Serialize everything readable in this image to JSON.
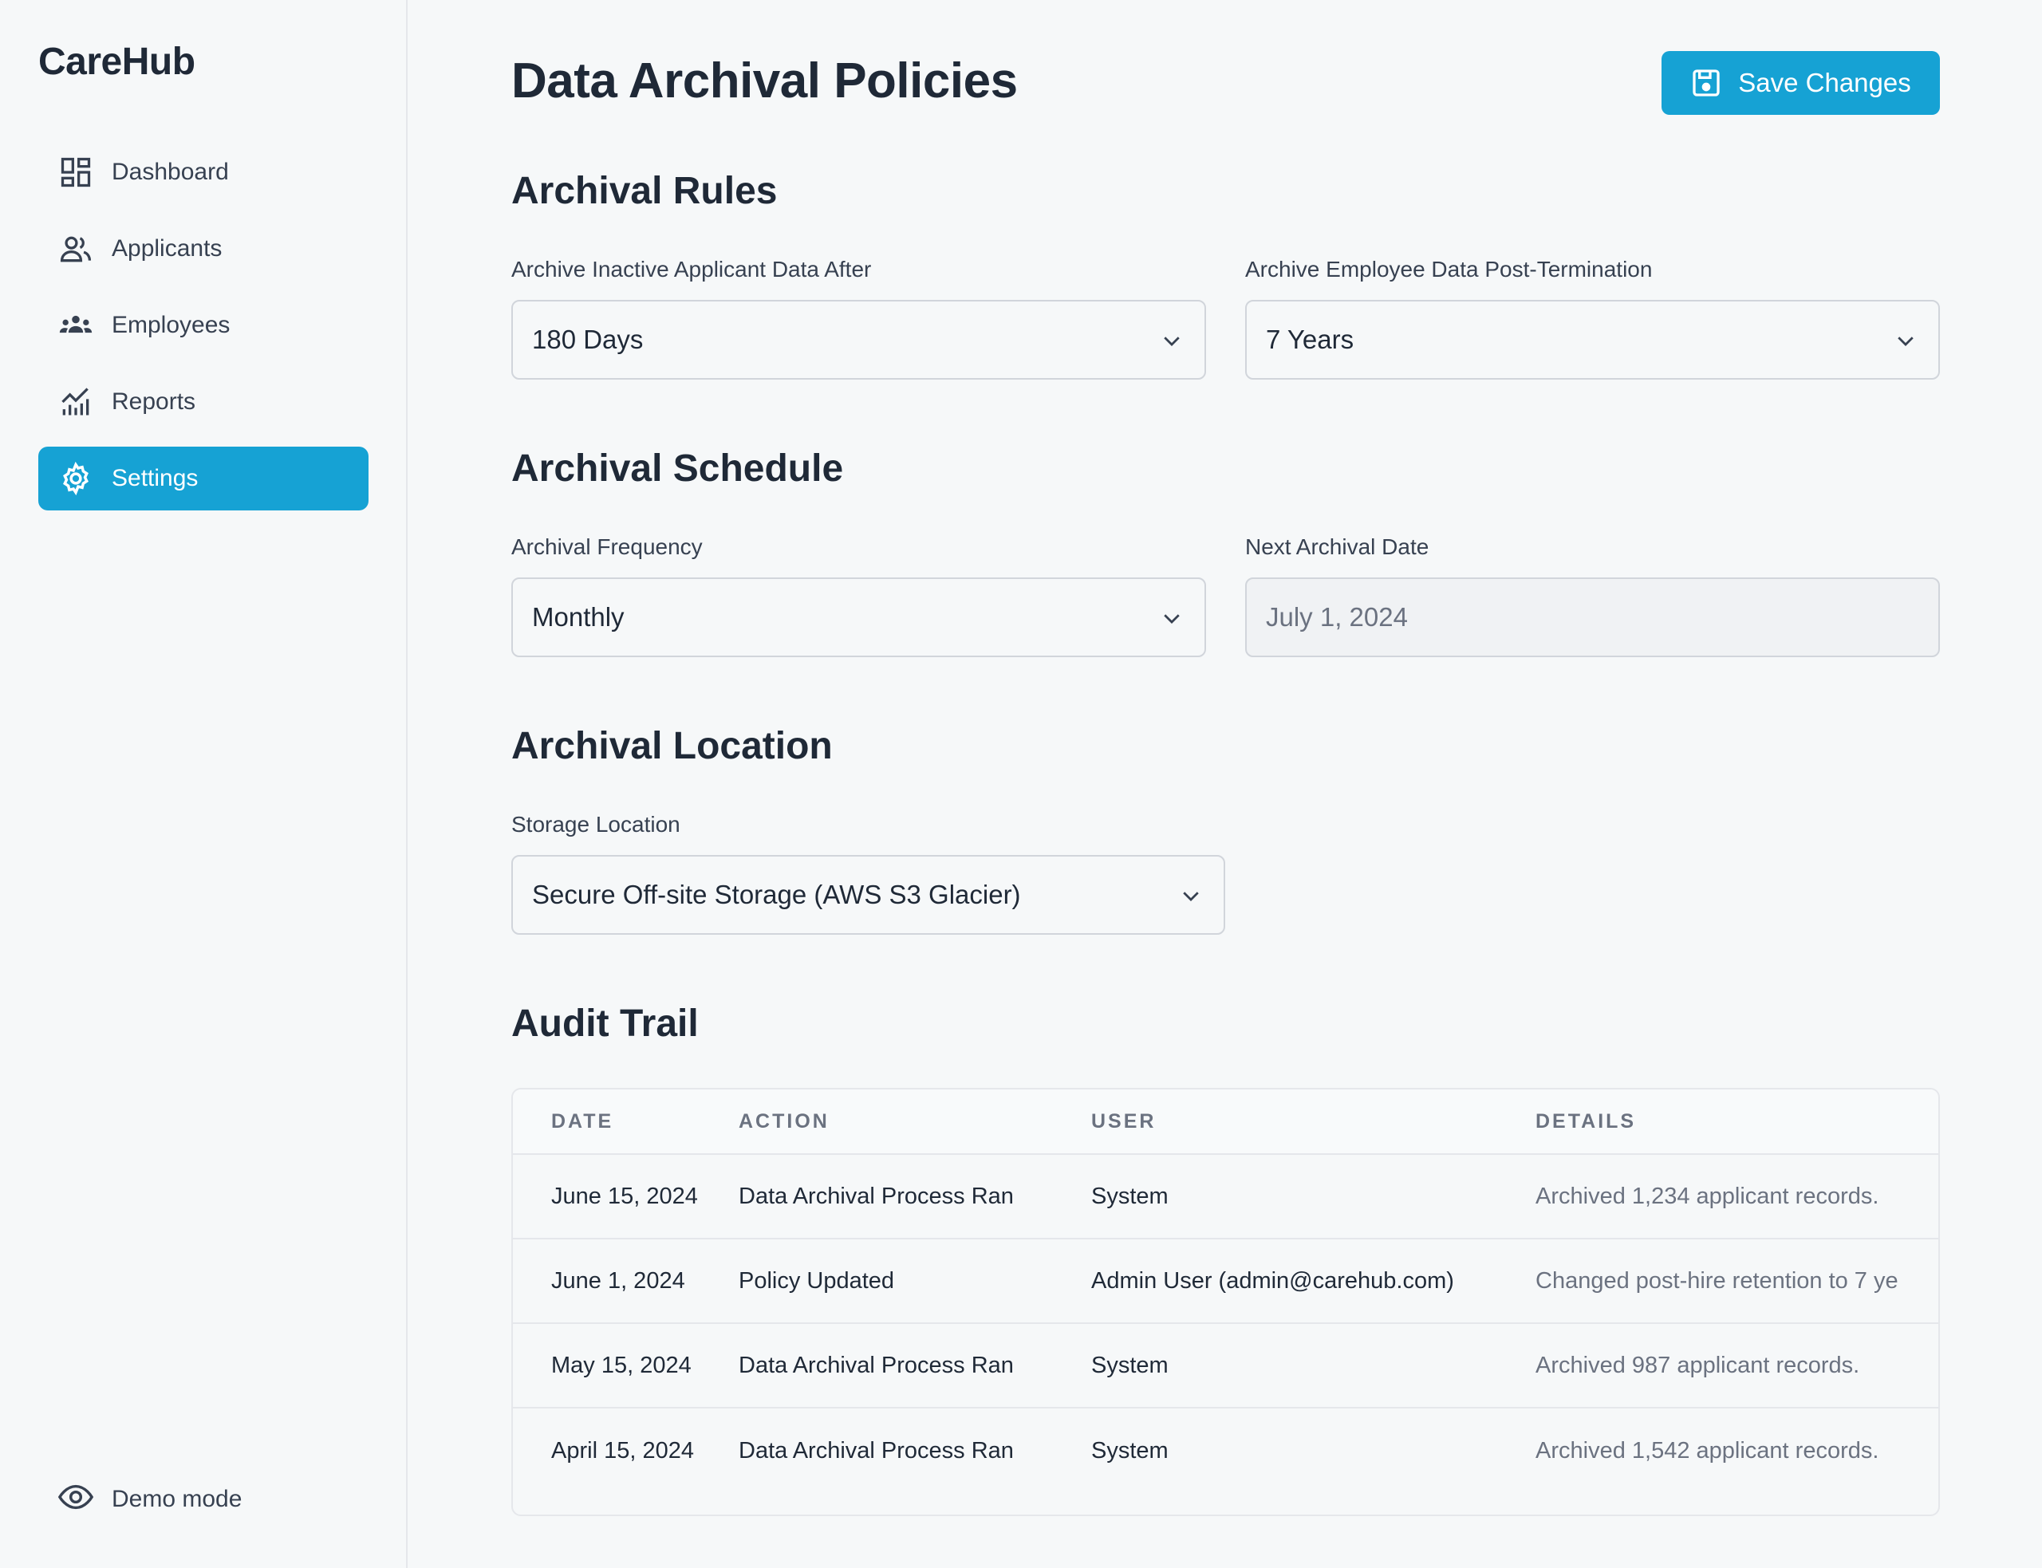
{
  "app": {
    "brand": "CareHub"
  },
  "sidebar": {
    "items": [
      {
        "label": "Dashboard",
        "icon": "dashboard-icon",
        "active": false
      },
      {
        "label": "Applicants",
        "icon": "users-icon",
        "active": false
      },
      {
        "label": "Employees",
        "icon": "group-icon",
        "active": false
      },
      {
        "label": "Reports",
        "icon": "chart-icon",
        "active": false
      },
      {
        "label": "Settings",
        "icon": "gear-icon",
        "active": true
      }
    ],
    "demo_label": "Demo mode"
  },
  "page": {
    "title": "Data Archival Policies",
    "save_label": "Save Changes"
  },
  "rules": {
    "title": "Archival Rules",
    "applicant_label": "Archive Inactive Applicant Data After",
    "applicant_value": "180 Days",
    "employee_label": "Archive Employee Data Post-Termination",
    "employee_value": "7 Years"
  },
  "schedule": {
    "title": "Archival Schedule",
    "frequency_label": "Archival Frequency",
    "frequency_value": "Monthly",
    "next_label": "Next Archival Date",
    "next_value": "July 1, 2024"
  },
  "location": {
    "title": "Archival Location",
    "storage_label": "Storage Location",
    "storage_value": "Secure Off-site Storage (AWS S3 Glacier)"
  },
  "audit": {
    "title": "Audit Trail",
    "columns": [
      "DATE",
      "ACTION",
      "USER",
      "DETAILS"
    ],
    "rows": [
      [
        "June 15, 2024",
        "Data Archival Process Ran",
        "System",
        "Archived 1,234 applicant records."
      ],
      [
        "June 1, 2024",
        "Policy Updated",
        "Admin User (admin@carehub.com)",
        "Changed post-hire retention to 7 ye"
      ],
      [
        "May 15, 2024",
        "Data Archival Process Ran",
        "System",
        "Archived 987 applicant records."
      ],
      [
        "April 15, 2024",
        "Data Archival Process Ran",
        "System",
        "Archived 1,542 applicant records."
      ]
    ]
  },
  "colors": {
    "accent": "#16a2d4",
    "text": "#1f2937",
    "muted": "#6b7280",
    "border": "#e5e7eb"
  }
}
